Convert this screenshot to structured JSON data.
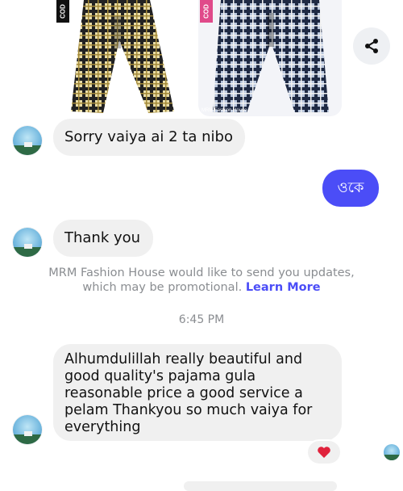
{
  "products": [
    {
      "code_label": "COD",
      "brand_label": ""
    },
    {
      "code_label": "COD",
      "brand_label": "MRM Fashion House"
    }
  ],
  "messages": {
    "msg1": "Sorry vaiya ai 2 ta nibo",
    "msg2_out": "ওকে",
    "msg3": "Thank you",
    "msg4": "Alhumdulillah really beautiful and good quality's pajama gula reasonable price a good service a pelam Thankyou so much vaiya for everything"
  },
  "notice": {
    "text": "MRM Fashion House would like to send you updates, which may be promotional.",
    "link": "Learn More"
  },
  "timestamp": "6:45 PM",
  "reaction": "heart",
  "icons": [
    "share-icon",
    "heart-icon",
    "avatar"
  ],
  "colors": {
    "accent": "#4b4df7",
    "bubble_in": "#f0f0f0",
    "meta_text": "#8a8d91",
    "heart": "#e0223c"
  }
}
